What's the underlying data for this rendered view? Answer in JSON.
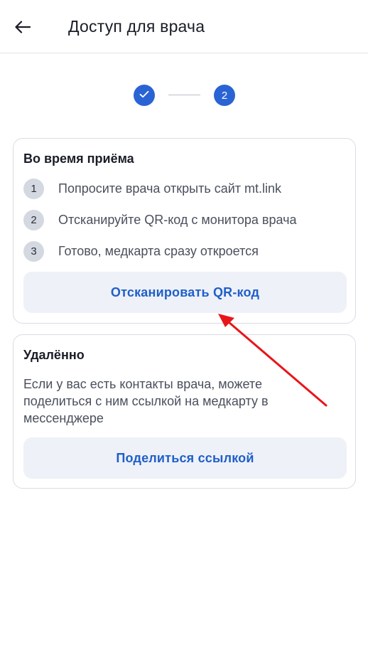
{
  "header": {
    "title": "Доступ для врача",
    "back_icon": "arrow-left-icon"
  },
  "stepper": {
    "done_icon": "check-icon",
    "current_step": "2",
    "accent": "#2a64d4"
  },
  "visit_card": {
    "title": "Во время приёма",
    "steps": [
      {
        "num": "1",
        "text": "Попросите врача открыть сайт mt.link"
      },
      {
        "num": "2",
        "text": "Отсканируйте QR-код с монитора врача"
      },
      {
        "num": "3",
        "text": "Готово, медкарта сразу откроется"
      }
    ],
    "button_label": "Отсканировать QR-код"
  },
  "remote_card": {
    "title": "Удалённо",
    "text": "Если у вас есть контакты врача, можете поделиться с ним ссылкой на медкарту в мессенджере",
    "button_label": "Поделиться ссылкой"
  },
  "colors": {
    "button_text": "#1f5fc9",
    "button_bg": "#eef1f8",
    "annotation": "#e8161b"
  }
}
